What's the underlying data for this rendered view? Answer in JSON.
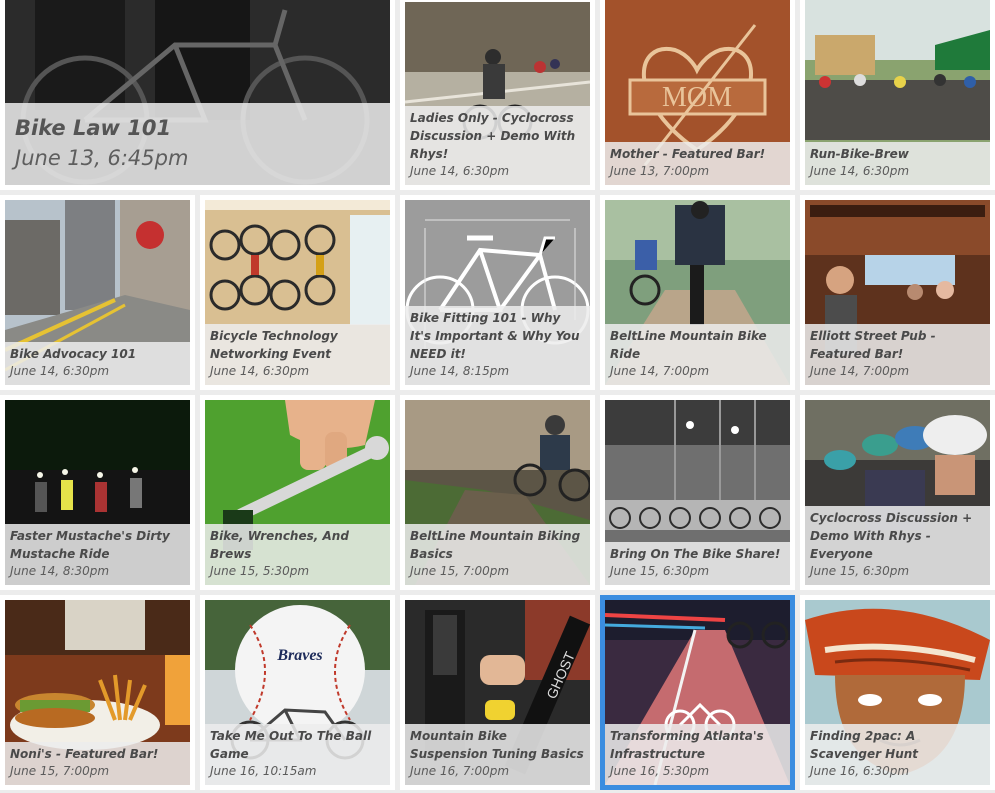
{
  "events": [
    {
      "title": "Bike Law 101",
      "date": "June 13, 6:45pm",
      "image": "tuxedo-bicycle-photo",
      "bg": "#2b2b2b"
    },
    {
      "title": "Ladies Only - Cyclocross Discussion + Demo With Rhys!",
      "date": "June 14, 6:30pm",
      "image": "cyclocross-race-photo",
      "bg": "#a7a294"
    },
    {
      "title": "Mother - Featured Bar!",
      "date": "June 13, 7:00pm",
      "image": "mom-heart-sign-photo",
      "bg": "#a3522b"
    },
    {
      "title": "Run-Bike-Brew",
      "date": "June 14, 6:30pm",
      "image": "cyclists-group-outdoors-photo",
      "bg": "#7b8d65"
    },
    {
      "title": "Bike Advocacy 101",
      "date": "June 14, 6:30pm",
      "image": "city-bike-lane-photo",
      "bg": "#8e8d88"
    },
    {
      "title": "Bicycle Technology Networking Event",
      "date": "June 14, 6:30pm",
      "image": "wall-mounted-bikes-photo",
      "bg": "#c3a77d"
    },
    {
      "title": "Bike Fitting 101 - Why It's Important & Why You NEED it!",
      "date": "June 14, 8:15pm",
      "image": "bike-geometry-diagram",
      "bg": "#9a9a9a"
    },
    {
      "title": "BeltLine Mountain Bike Ride",
      "date": "June 14, 7:00pm",
      "image": "mountain-bike-riders-photo",
      "bg": "#6f8a6c"
    },
    {
      "title": "Elliott Street Pub - Featured Bar!",
      "date": "June 14, 7:00pm",
      "image": "pub-interior-photo",
      "bg": "#6a3a22"
    },
    {
      "title": "Faster Mustache's Dirty Mustache Ride",
      "date": "June 14, 8:30pm",
      "image": "night-ride-photo",
      "bg": "#151515"
    },
    {
      "title": "Bike, Wrenches, And Brews",
      "date": "June 15, 5:30pm",
      "image": "hand-with-wrench-photo",
      "bg": "#4fa12f"
    },
    {
      "title": "BeltLine Mountain Biking Basics",
      "date": "June 15, 7:00pm",
      "image": "muddy-trail-photo",
      "bg": "#5c5546"
    },
    {
      "title": "Bring On The Bike Share!",
      "date": "June 15, 6:30pm",
      "image": "bike-share-warehouse-photo",
      "bg": "#7d7d7d"
    },
    {
      "title": "Cyclocross Discussion + Demo With Rhys - Everyone",
      "date": "June 15, 6:30pm",
      "image": "cyclists-helmets-photo",
      "bg": "#3c3a38"
    },
    {
      "title": "Noni's - Featured Bar!",
      "date": "June 15, 7:00pm",
      "image": "sandwich-and-fries-photo",
      "bg": "#7d3a1c"
    },
    {
      "title": "Take Me Out To The Ball Game",
      "date": "June 16, 10:15am",
      "image": "giant-baseball-photo",
      "bg": "#c9c9c9"
    },
    {
      "title": "Mountain Bike Suspension Tuning Basics",
      "date": "June 16, 7:00pm",
      "image": "suspension-fork-photo",
      "bg": "#3a3a3a"
    },
    {
      "title": "Transforming Atlanta's Infrastructure",
      "date": "June 16, 5:30pm",
      "image": "bike-lane-marking-photo",
      "bg": "#9f4a55"
    },
    {
      "title": "Finding 2pac: A Scavenger Hunt",
      "date": "June 16, 6:30pm",
      "image": "2pac-illustration",
      "bg": "#a9c9cf"
    }
  ],
  "selected_index": 17
}
